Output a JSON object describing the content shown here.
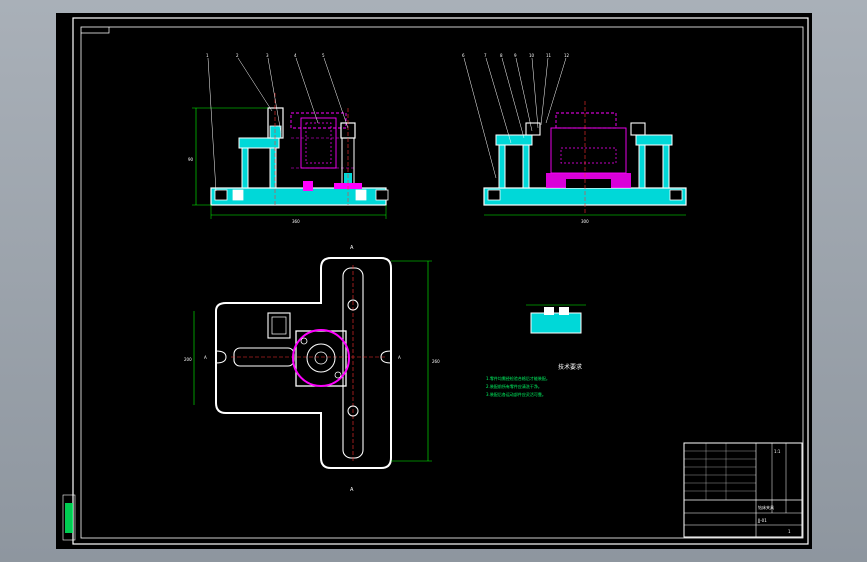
{
  "drawing": {
    "notes_title": "技术要求",
    "notes": [
      "1.零件均需经检验合格后才能装配。",
      "2.装配前所有零件应清洗干净。",
      "3.装配后各运动部件应灵活可靠。"
    ],
    "section_marks": {
      "top_view_label": "A",
      "bottom_view_label": "A",
      "left_marker": "A",
      "right_marker": "A"
    },
    "front_view_balloons": [
      "1",
      "2",
      "3",
      "4",
      "5"
    ],
    "side_view_balloons": [
      "6",
      "7",
      "8",
      "9",
      "10",
      "11",
      "12"
    ],
    "dimensions": {
      "front_width": "360",
      "front_height": "90",
      "side_width": "300",
      "plan_height": "260",
      "plan_width": "200"
    },
    "title_block": {
      "name": "钻床夹具",
      "drawing_no": "JJ-01",
      "scale": "1:1",
      "sheet": "1"
    }
  },
  "colors": {
    "outline": "#ffffff",
    "fill_cyan": "#00d8d8",
    "hidden_magenta": "#ff00ff",
    "dimension_green": "#00ff00",
    "background": "#000000"
  }
}
